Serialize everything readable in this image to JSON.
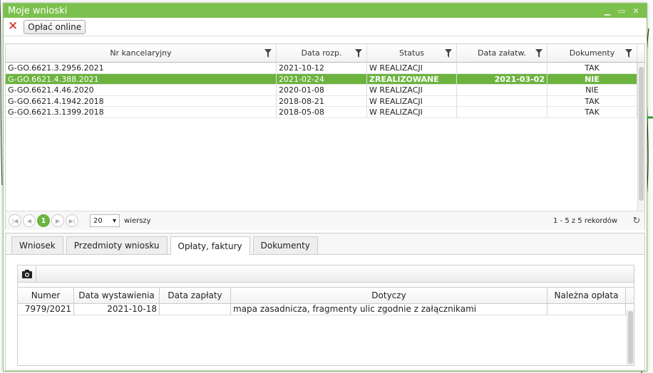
{
  "window": {
    "title": "Moje wnioski"
  },
  "toolbar": {
    "pay_label": "Opłać online"
  },
  "grid": {
    "columns": [
      "Nr kancelaryjny",
      "Data rozp.",
      "Status",
      "Data załatw.",
      "Dokumenty"
    ],
    "rows": [
      [
        "G-GO.6621.3.2956.2021",
        "2021-10-12",
        "W REALIZACJI",
        "",
        "TAK"
      ],
      [
        "G-GO.6621.4.388.2021",
        "2021-02-24",
        "ZREALIZOWANE",
        "2021-03-02",
        "NIE"
      ],
      [
        "G-GO.6621.4.46.2020",
        "2020-01-08",
        "W REALIZACJI",
        "",
        "NIE"
      ],
      [
        "G-GO.6621.4.1942.2018",
        "2018-08-21",
        "W REALIZACJI",
        "",
        "TAK"
      ],
      [
        "G-GO.6621.3.1399.2018",
        "2018-05-08",
        "W REALIZACJI",
        "",
        "TAK"
      ]
    ],
    "selected_row": 1
  },
  "pager": {
    "current_page": "1",
    "page_size": "20",
    "page_size_suffix": "wierszy",
    "summary": "1 - 5 z 5 rekordów"
  },
  "tabs": [
    "Wniosek",
    "Przedmioty wniosku",
    "Opłaty, faktury",
    "Dokumenty"
  ],
  "active_tab": 2,
  "payments": {
    "columns": [
      "Numer",
      "Data wystawienia",
      "Data zapłaty",
      "Dotyczy",
      "Należna opłata"
    ],
    "rows": [
      [
        "7979/2021",
        "2021-10-18",
        "",
        "mapa zasadnicza, fragmenty ulic zgodnie z załącznikami",
        ""
      ]
    ]
  },
  "colors": {
    "accent": "#6cb33f",
    "titlebar": "#7cc04d",
    "close": "#d9261c"
  }
}
